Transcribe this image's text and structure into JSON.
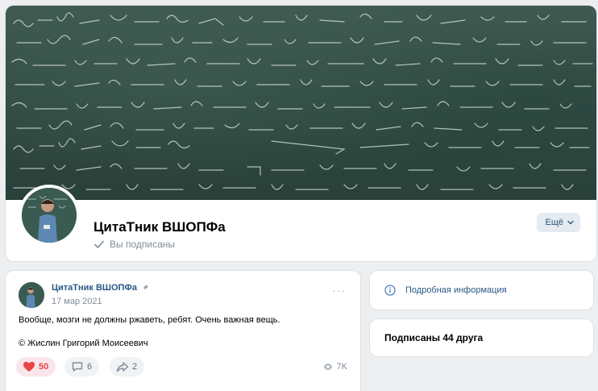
{
  "group": {
    "name": "ЦитаТник ВШОПФа",
    "subscribed_status": "Вы подписаны",
    "more_label": "Ещё",
    "cover_icon": "chalkboard-formulas",
    "avatar_icon": "lecturer-photo"
  },
  "post": {
    "author": "ЦитаТник ВШОПФа",
    "date": "17 мар 2021",
    "menu_label": "···",
    "text": "Вообще, мозги не должны ржаветь, ребят. Очень важная вещь.",
    "signature": "© Жислин Григорий Моисеевич",
    "likes": "50",
    "comments": "6",
    "shares": "2",
    "views": "7K"
  },
  "sidebar": {
    "info_label": "Подробная информация",
    "friends_label": "Подписаны 44 друга"
  },
  "colors": {
    "accent_link": "#2a5885",
    "like_red": "#e64646",
    "page_bg": "#edeef0",
    "chalkboard": "#2f4a42"
  }
}
